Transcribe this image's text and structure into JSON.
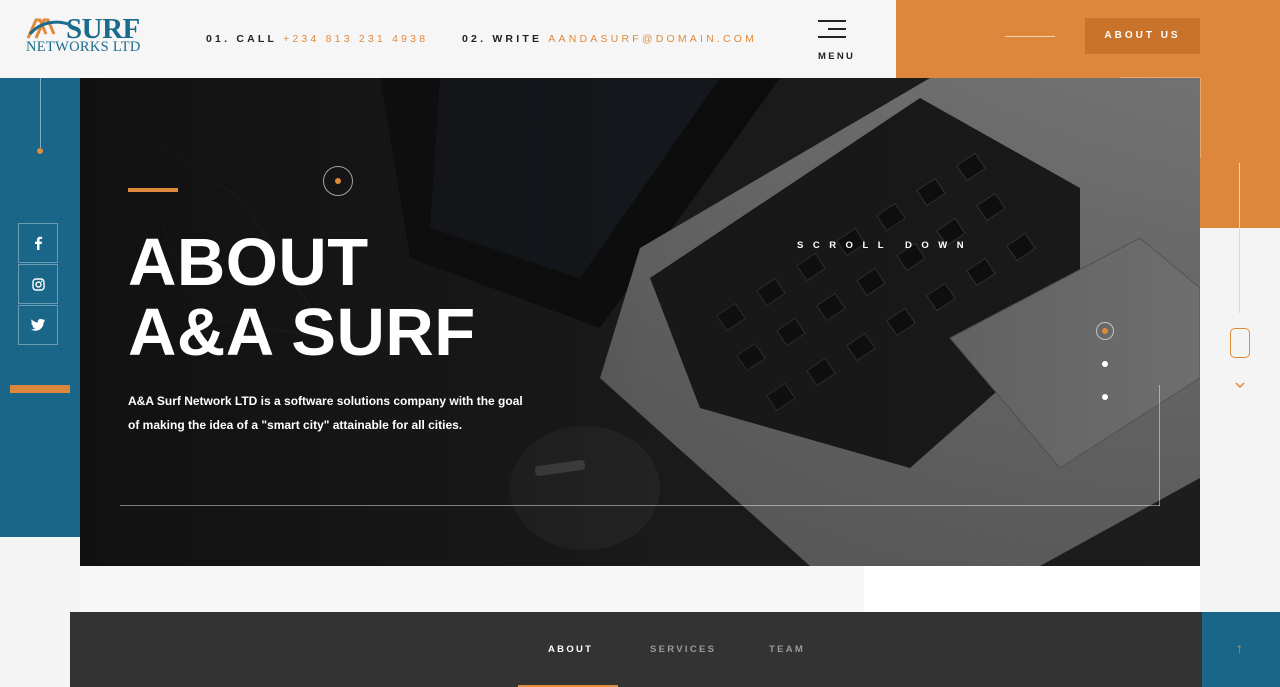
{
  "header": {
    "logo_surf": "SURF",
    "logo_networks": "NETWORKS LTD",
    "call_label": "01. CALL",
    "call_value": "+234 813 231 4938",
    "write_label": "02. WRITE",
    "write_value": "AANDASURF@DOMAIN.COM",
    "menu_label": "MENU",
    "about_button": "ABOUT US"
  },
  "social": [
    {
      "icon": "facebook-icon"
    },
    {
      "icon": "instagram-icon"
    },
    {
      "icon": "twitter-icon"
    }
  ],
  "hero": {
    "title_line1": "ABOUT",
    "title_line2": "A&A SURF",
    "description": "A&A Surf Network LTD is a software solutions company with the goal of making the idea of a \"smart city\" attainable for all cities.",
    "scroll_label": "SCROLL DOWN",
    "slides_count": 3,
    "active_slide": 1
  },
  "bottom_nav": {
    "items": [
      "ABOUT",
      "SERVICES",
      "TEAM"
    ],
    "active": "ABOUT"
  },
  "colors": {
    "accent_orange": "#dc873b",
    "brand_blue": "#1a6689",
    "dark_bar": "#333333"
  }
}
